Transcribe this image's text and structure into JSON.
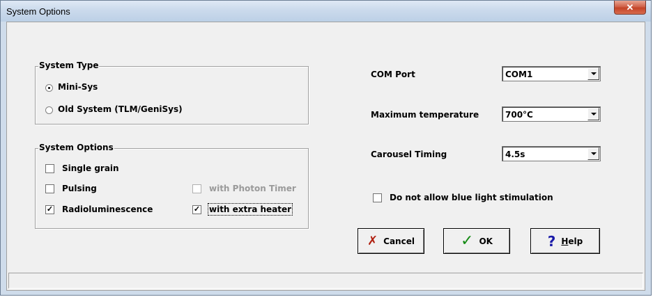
{
  "window": {
    "title": "System Options",
    "close_glyph": "✕"
  },
  "system_type": {
    "title": "System Type",
    "options": [
      {
        "label": "Mini-Sys",
        "selected": true
      },
      {
        "label": "Old System (TLM/GeniSys)",
        "selected": false
      }
    ]
  },
  "system_options": {
    "title": "System Options",
    "single_grain": {
      "label": "Single grain",
      "checked": false
    },
    "pulsing": {
      "label": "Pulsing",
      "checked": false
    },
    "photon_timer": {
      "label": "with Photon Timer",
      "checked": false,
      "enabled": false
    },
    "radioluminescence": {
      "label": "Radioluminescence",
      "checked": true
    },
    "extra_heater": {
      "label": "with extra heater",
      "checked": true
    }
  },
  "settings": {
    "com_port": {
      "label": "COM Port",
      "value": "COM1"
    },
    "max_temp": {
      "label": "Maximum temperature",
      "value": "700°C"
    },
    "carousel": {
      "label": "Carousel Timing",
      "value": "4.5s"
    },
    "blue_light": {
      "label": "Do not allow blue light stimulation",
      "checked": false
    }
  },
  "buttons": {
    "cancel": "Cancel",
    "ok": "OK",
    "help_mnemonic": "H",
    "help_rest": "elp"
  },
  "icons": {
    "cancel": "✗",
    "ok": "✓",
    "help": "?"
  },
  "colors": {
    "cancel_icon": "#b02010",
    "ok_icon": "#138a13",
    "help_icon": "#1a1aa8"
  }
}
